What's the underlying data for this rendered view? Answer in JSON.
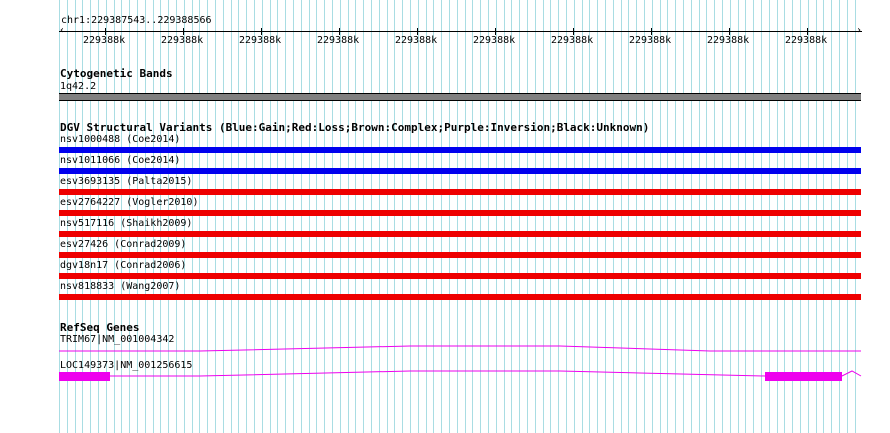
{
  "ruler": {
    "position": "chr1:229387543..229388566",
    "tick_labels": [
      "229388k",
      "229388k",
      "229388k",
      "229388k",
      "229388k",
      "229388k",
      "229388k",
      "229388k",
      "229388k",
      "229388k"
    ]
  },
  "cytoband": {
    "title": "Cytogenetic Bands",
    "band": "1q42.2",
    "color": "#808080"
  },
  "dgv": {
    "title": "DGV Structural Variants (Blue:Gain;Red:Loss;Brown:Complex;Purple:Inversion;Black:Unknown)",
    "variants": [
      {
        "label": "nsv1000488 (Coe2014)",
        "color": "#0000ee"
      },
      {
        "label": "nsv1011066 (Coe2014)",
        "color": "#0000ee"
      },
      {
        "label": "esv3693135 (Palta2015)",
        "color": "#ee0000"
      },
      {
        "label": "esv2764227 (Vogler2010)",
        "color": "#ee0000"
      },
      {
        "label": "nsv517116 (Shaikh2009)",
        "color": "#ee0000"
      },
      {
        "label": "esv27426 (Conrad2009)",
        "color": "#ee0000"
      },
      {
        "label": "dgv18n17 (Conrad2006)",
        "color": "#ee0000"
      },
      {
        "label": "nsv818833 (Wang2007)",
        "color": "#ee0000"
      }
    ]
  },
  "refseq": {
    "title": "RefSeq Genes",
    "genes": [
      {
        "label": "TRIM67|NM_001004342",
        "color": "#ee00ee"
      },
      {
        "label": "LOC149373|NM_001256615",
        "color": "#ee00ee"
      }
    ]
  }
}
